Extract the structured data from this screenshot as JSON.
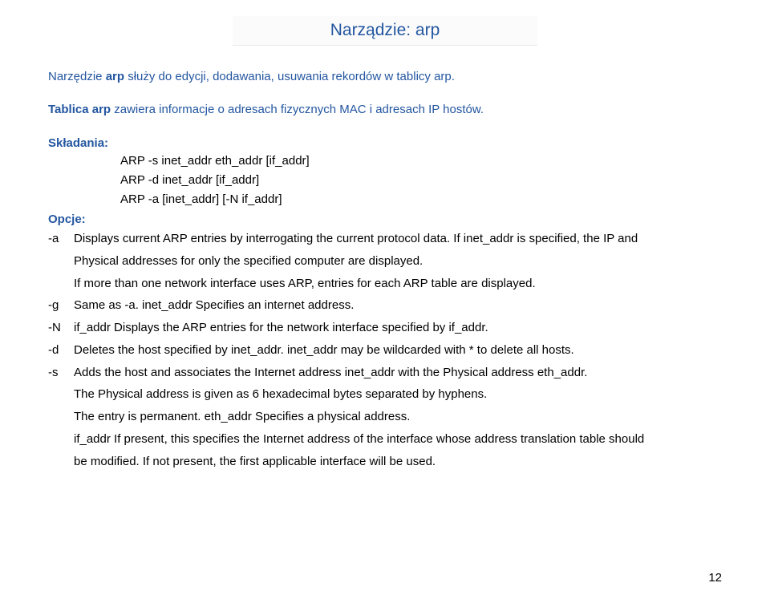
{
  "title": "Narządzie: arp",
  "intro1_pre": "Narzędzie ",
  "intro1_bold": "arp",
  "intro1_post": " służy do edycji, dodawania, usuwania rekordów w tablicy arp.",
  "intro2_bold": "Tablica arp",
  "intro2_post": " zawiera informacje o adresach fizycznych MAC i adresach IP hostów.",
  "label_syntax": "Składania:",
  "label_options": "Opcje:",
  "syntax": {
    "l1": "ARP -s inet_addr eth_addr [if_addr]",
    "l2": "ARP -d inet_addr [if_addr]",
    "l3": "ARP -a [inet_addr] [-N if_addr]"
  },
  "opts": {
    "a_flag": "-a",
    "a_text1": "Displays current ARP entries by interrogating the current protocol data.  If inet_addr is  specified, the IP and",
    "a_text2": "Physical addresses for only the specified computer are displayed.",
    "a_text3": "If more than one network interface uses ARP, entries for each ARP table are displayed.",
    "g_flag": "-g",
    "g_text": "Same as -a.  inet_addr  Specifies an internet address.",
    "N_flag": "-N",
    "N_text": "if_addr  Displays the ARP entries for the network interface specified by if_addr.",
    "d_flag": "-d",
    "d_text": "Deletes the host specified by inet_addr. inet_addr may be wildcarded with * to delete all hosts.",
    "s_flag": "-s",
    "s_text1": " Adds the host and associates the Internet address inet_addr with the Physical address eth_addr.",
    "s_text2": "The Physical address is given as 6 hexadecimal bytes separated by hyphens.",
    "s_text3": "The entry is permanent. eth_addr   Specifies a physical address.",
    "s_text4": "if_addr  If present, this specifies the Internet address of the interface whose address translation table should",
    "s_text5": "be modified. If not present, the first applicable interface will be used."
  },
  "page_number": "12"
}
